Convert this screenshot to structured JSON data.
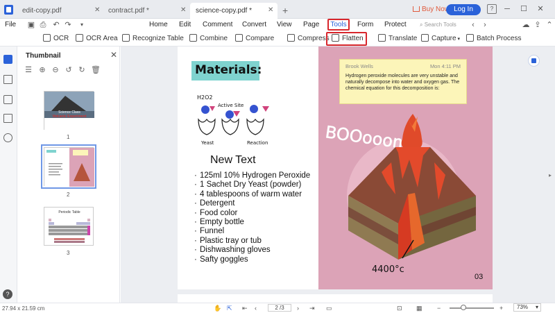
{
  "tabs": [
    {
      "label": "edit-copy.pdf",
      "active": false
    },
    {
      "label": "contract.pdf *",
      "active": false
    },
    {
      "label": "science-copy.pdf *",
      "active": true
    }
  ],
  "titlebar": {
    "buy_now": "Buy Now",
    "login": "Log In",
    "help": "?",
    "minimize": "─",
    "maximize": "☐",
    "close": "✕"
  },
  "menu": {
    "file": "File",
    "items": [
      "Home",
      "Edit",
      "Comment",
      "Convert",
      "View",
      "Page",
      "Tools",
      "Form",
      "Protect"
    ],
    "search_placeholder": "Search Tools"
  },
  "toolbar": {
    "items": [
      "OCR",
      "OCR Area",
      "Recognize Table",
      "Combine",
      "Compare",
      "Compress",
      "Flatten",
      "Translate",
      "Capture",
      "Batch Process"
    ]
  },
  "thumbnail_panel": {
    "title": "Thumbnail",
    "pages": [
      "1",
      "2",
      "3"
    ],
    "thumb1": {
      "title": "Science Class",
      "subtitle": "Volcanic Experiment"
    },
    "thumb3": {
      "title": "Periodic Table"
    }
  },
  "document": {
    "heading": "Materials:",
    "diagram_labels": {
      "h2o2": "H2O2",
      "active_site": "Active Site",
      "yeast": "Yeast",
      "reaction": "Reaction"
    },
    "new_text": "New Text",
    "list": [
      "125ml 10% Hydrogen Peroxide",
      "1 Sachet Dry Yeast (powder)",
      "4 tablespoons of warm water",
      "Detergent",
      "Food color",
      "Empty bottle",
      "Funnel",
      "Plastic tray or tub",
      "Dishwashing gloves",
      "Safty goggles"
    ],
    "sticky_note": {
      "author": "Brook Wells",
      "time": "Mon 4:11 PM",
      "body": "Hydrogen peroxide molecules are very unstable and naturally decompose into water and oxygen gas. The chemical equation for this decomposition is:"
    },
    "volcano_text": "BOOooom!",
    "temperature": "4400°c",
    "page_number": "03"
  },
  "statusbar": {
    "dimensions": "27.94 x 21.59 cm",
    "page_indicator": "2 /3",
    "zoom": "73%",
    "zoom_level": 0.73
  },
  "colors": {
    "accent": "#2b62d9",
    "highlight_box": "#d8262c",
    "materials_bg": "#7fd3cf",
    "right_page_bg": "#dca3b7",
    "sticky_bg": "#fcf5b9"
  }
}
